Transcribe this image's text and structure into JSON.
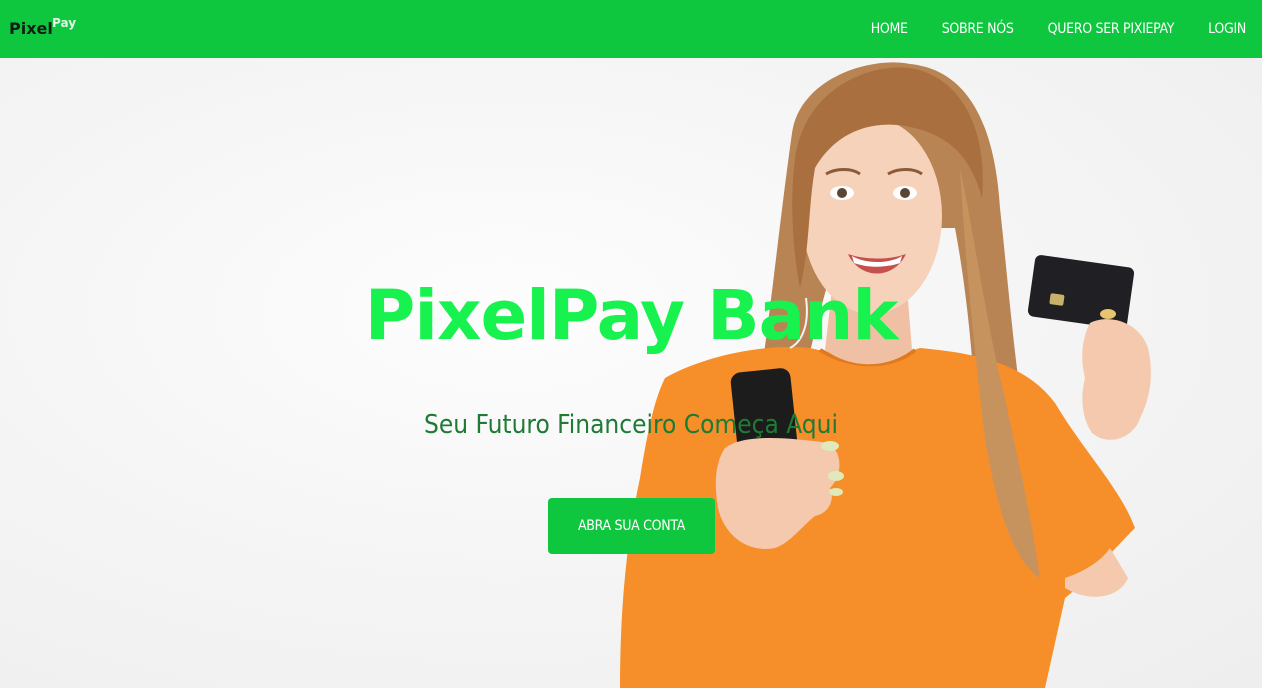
{
  "brand": {
    "logo_main": "Pixel",
    "logo_sup": "Pay"
  },
  "nav": {
    "items": [
      "HOME",
      "SOBRE NÓS",
      "QUERO SER PIXIEPAY",
      "LOGIN"
    ]
  },
  "hero": {
    "title": "PixelPay Bank",
    "subtitle": "Seu Futuro Financeiro Começa Aqui",
    "cta_label": "ABRA SUA CONTA"
  },
  "colors": {
    "brand_green": "#0fc63f",
    "title_green": "#17f24f",
    "subtitle_green": "#1f7a36",
    "shirt_orange": "#f68e2a"
  },
  "icons": {
    "photo": "woman-holding-phone-and-card-photo"
  }
}
